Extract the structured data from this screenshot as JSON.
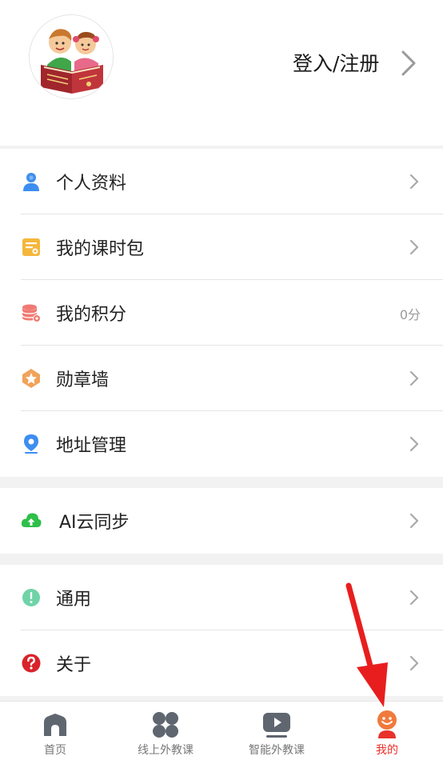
{
  "header": {
    "avatar_alt": "kids reading book",
    "login_label": "登入/注册"
  },
  "menu_group_1": [
    {
      "label": "个人资料",
      "icon": "person-icon",
      "color": "#3d8ef0"
    },
    {
      "label": "我的课时包",
      "icon": "lesson-package-icon",
      "color": "#f4b73c"
    },
    {
      "label": "我的积分",
      "icon": "points-coins-icon",
      "color": "#f07a74",
      "value": "0分"
    },
    {
      "label": "勋章墙",
      "icon": "medal-icon",
      "color": "#f0a35a"
    },
    {
      "label": "地址管理",
      "icon": "location-pin-icon",
      "color": "#3d8ef0"
    }
  ],
  "menu_group_2": [
    {
      "label": "AI云同步",
      "icon": "cloud-upload-icon",
      "color": "#2fbf4a"
    }
  ],
  "menu_group_3": [
    {
      "label": "通用",
      "icon": "info-circle-icon",
      "color": "#6fd3a8"
    },
    {
      "label": "关于",
      "icon": "help-circle-icon",
      "color": "#d9232a"
    }
  ],
  "tabbar": [
    {
      "label": "首页",
      "icon": "home-icon",
      "active": false
    },
    {
      "label": "线上外教课",
      "icon": "four-leaf-icon",
      "active": false
    },
    {
      "label": "智能外教课",
      "icon": "video-play-icon",
      "active": false
    },
    {
      "label": "我的",
      "icon": "profile-smile-icon",
      "active": true
    }
  ],
  "colors": {
    "accent": "#e8322b",
    "text": "#222222",
    "muted": "#9a9a9a",
    "divider": "#e4e4e4",
    "background": "#f2f2f2"
  }
}
